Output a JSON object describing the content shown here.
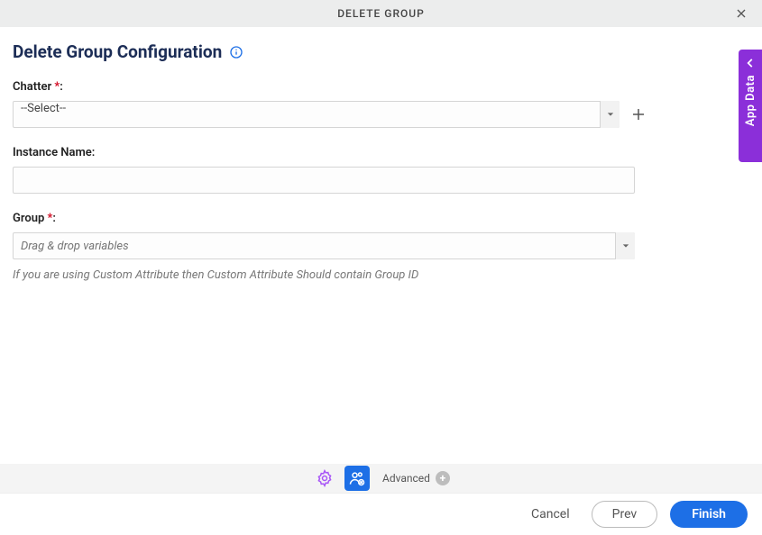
{
  "header": {
    "title": "DELETE GROUP"
  },
  "page": {
    "title": "Delete Group Configuration"
  },
  "fields": {
    "chatter": {
      "label": "Chatter ",
      "value": "--Select--"
    },
    "instance": {
      "label": "Instance Name:",
      "value": ""
    },
    "group": {
      "label": "Group ",
      "placeholder": "Drag & drop variables"
    },
    "hint": "If you are using Custom Attribute then Custom Attribute Should contain Group ID"
  },
  "tabs": {
    "advanced_label": "Advanced"
  },
  "footer": {
    "cancel": "Cancel",
    "prev": "Prev",
    "finish": "Finish"
  },
  "side": {
    "label": "App Data"
  },
  "required_mark": "*",
  "colon": ":"
}
